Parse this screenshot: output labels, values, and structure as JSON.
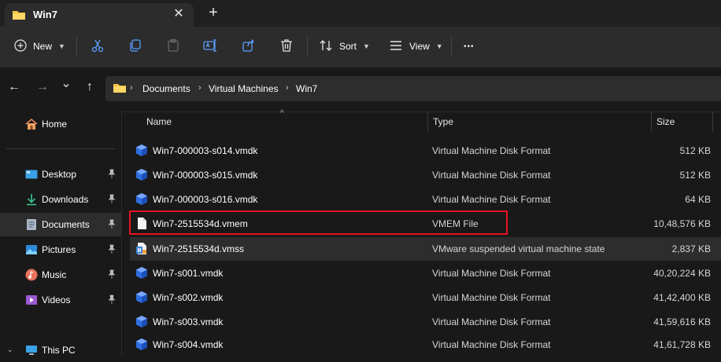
{
  "window": {
    "tab_title": "Win7",
    "close_glyph": "✕",
    "new_tab_glyph": "+"
  },
  "toolbar": {
    "new_label": "New",
    "sort_label": "Sort",
    "view_label": "View",
    "more_glyph": "•••",
    "icons": [
      "plus-circle-icon",
      "cut-icon",
      "copy-icon",
      "paste-icon",
      "rename-icon",
      "share-icon",
      "delete-icon",
      "sort-icon",
      "view-icon",
      "more-icon"
    ]
  },
  "navigation": {
    "back_glyph": "←",
    "forward_glyph": "→",
    "recent_glyph": "⌄",
    "up_glyph": "↑"
  },
  "breadcrumb": {
    "items": [
      "Documents",
      "Virtual Machines",
      "Win7"
    ],
    "separator": "›"
  },
  "sidebar": {
    "home_label": "Home",
    "pin_glyph": "📌",
    "items": [
      {
        "label": "Desktop",
        "icon": "desktop-icon",
        "pinned": true
      },
      {
        "label": "Downloads",
        "icon": "download-icon",
        "pinned": true
      },
      {
        "label": "Documents",
        "icon": "documents-icon",
        "pinned": true,
        "selected": true
      },
      {
        "label": "Pictures",
        "icon": "pictures-icon",
        "pinned": true
      },
      {
        "label": "Music",
        "icon": "music-icon",
        "pinned": true
      },
      {
        "label": "Videos",
        "icon": "videos-icon",
        "pinned": true
      }
    ],
    "this_pc_label": "This PC",
    "expand_glyph": "⌄"
  },
  "file_list": {
    "columns": {
      "name": "Name",
      "type": "Type",
      "size": "Size"
    },
    "sort_glyph": "^",
    "rows": [
      {
        "name": "Win7-000003-s014.vmdk",
        "type": "Virtual Machine Disk Format",
        "size": "512 KB",
        "icon": "vmdk-icon"
      },
      {
        "name": "Win7-000003-s015.vmdk",
        "type": "Virtual Machine Disk Format",
        "size": "512 KB",
        "icon": "vmdk-icon"
      },
      {
        "name": "Win7-000003-s016.vmdk",
        "type": "Virtual Machine Disk Format",
        "size": "64 KB",
        "icon": "vmdk-icon"
      },
      {
        "name": "Win7-2515534d.vmem",
        "type": "VMEM File",
        "size": "10,48,576 KB",
        "icon": "blank-file-icon",
        "annotated": true
      },
      {
        "name": "Win7-2515534d.vmss",
        "type": "VMware suspended virtual machine state",
        "size": "2,837 KB",
        "icon": "vmss-icon",
        "highlighted": true
      },
      {
        "name": "Win7-s001.vmdk",
        "type": "Virtual Machine Disk Format",
        "size": "40,20,224 KB",
        "icon": "vmdk-icon"
      },
      {
        "name": "Win7-s002.vmdk",
        "type": "Virtual Machine Disk Format",
        "size": "41,42,400 KB",
        "icon": "vmdk-icon"
      },
      {
        "name": "Win7-s003.vmdk",
        "type": "Virtual Machine Disk Format",
        "size": "41,59,616 KB",
        "icon": "vmdk-icon"
      },
      {
        "name": "Win7-s004.vmdk",
        "type": "Virtual Machine Disk Format",
        "size": "41,61,728 KB",
        "icon": "vmdk-icon"
      }
    ]
  },
  "colors": {
    "annotation": "#e81123",
    "folder": "#f4c542",
    "vmdk": "#2f6fe0"
  }
}
